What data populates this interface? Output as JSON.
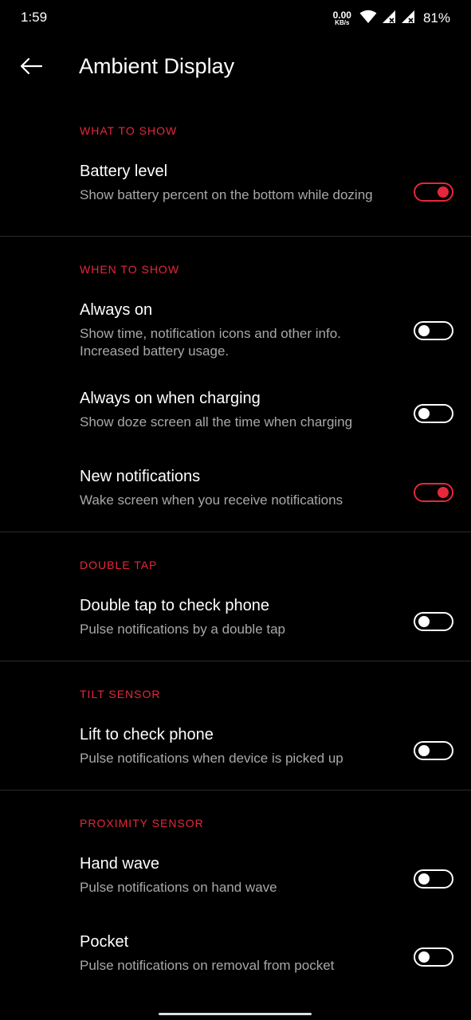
{
  "status_bar": {
    "time": "1:59",
    "net_speed_value": "0.00",
    "net_speed_unit": "KB/s",
    "battery_percent": "81%",
    "icons": [
      "wifi-icon",
      "signal-icon",
      "signal-icon",
      "battery-icon"
    ]
  },
  "app_bar": {
    "title": "Ambient Display",
    "back_icon": "arrow-left-icon"
  },
  "colors": {
    "accent": "#e5283b",
    "background": "#000000",
    "summary_text": "#a8a8a8"
  },
  "sections": [
    {
      "header": "WHAT TO SHOW",
      "items": [
        {
          "title": "Battery level",
          "summary": "Show battery percent on the bottom while dozing",
          "enabled": true
        }
      ]
    },
    {
      "header": "WHEN TO SHOW",
      "items": [
        {
          "title": "Always on",
          "summary": "Show time, notification icons and other info. Increased battery usage.",
          "enabled": false
        },
        {
          "title": "Always on when charging",
          "summary": "Show doze screen all the time when charging",
          "enabled": false
        },
        {
          "title": "New notifications",
          "summary": "Wake screen when you receive notifications",
          "enabled": true
        }
      ]
    },
    {
      "header": "DOUBLE TAP",
      "items": [
        {
          "title": "Double tap to check phone",
          "summary": "Pulse notifications by a double tap",
          "enabled": false
        }
      ]
    },
    {
      "header": "TILT SENSOR",
      "items": [
        {
          "title": "Lift to check phone",
          "summary": "Pulse notifications when device is picked up",
          "enabled": false
        }
      ]
    },
    {
      "header": "PROXIMITY SENSOR",
      "items": [
        {
          "title": "Hand wave",
          "summary": "Pulse notifications on hand wave",
          "enabled": false
        },
        {
          "title": "Pocket",
          "summary": "Pulse notifications on removal from pocket",
          "enabled": false
        }
      ]
    }
  ]
}
